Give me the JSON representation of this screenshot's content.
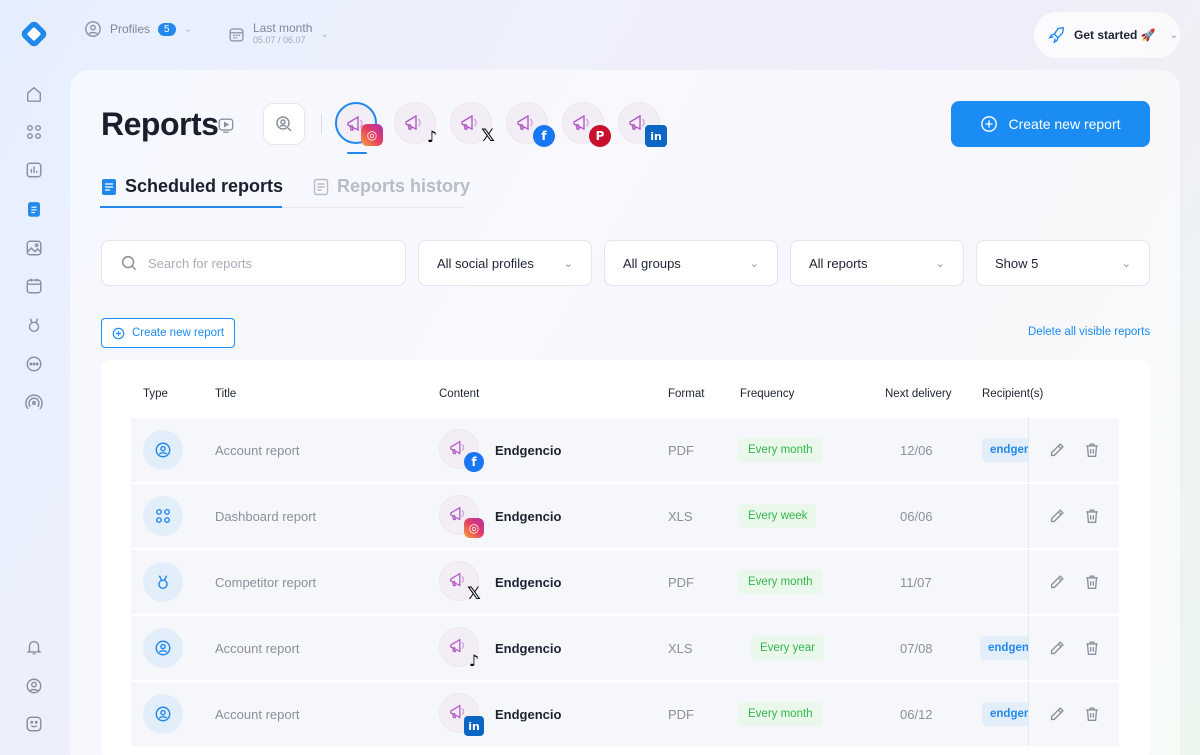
{
  "topbar": {
    "profiles_label": "Profiles",
    "profiles_count": "5",
    "period_label": "Last month",
    "period_range": "05.07 / 06.07",
    "get_started": "Get started 🚀"
  },
  "sidebar": {
    "items": [
      "home-icon",
      "grid-icon",
      "chart-icon",
      "report-icon",
      "media-icon",
      "calendar-icon",
      "trophy-icon",
      "chat-icon",
      "broadcast-icon"
    ],
    "bottom": [
      "bell-icon",
      "user-icon",
      "smile-icon"
    ],
    "active": "report-icon"
  },
  "page": {
    "title": "Reports",
    "create_button": "Create new report"
  },
  "profiles": [
    {
      "network": "instagram",
      "selected": true
    },
    {
      "network": "tiktok"
    },
    {
      "network": "x"
    },
    {
      "network": "facebook"
    },
    {
      "network": "pinterest"
    },
    {
      "network": "linkedin"
    }
  ],
  "tabs": {
    "scheduled": "Scheduled reports",
    "history": "Reports history"
  },
  "filters": {
    "search_placeholder": "Search for reports",
    "profiles": "All social profiles",
    "groups": "All groups",
    "reports": "All reports",
    "show": "Show 5"
  },
  "actions": {
    "create_small": "Create new report",
    "delete_all": "Delete all visible reports"
  },
  "table": {
    "headers": {
      "type": "Type",
      "title": "Title",
      "content": "Content",
      "format": "Format",
      "frequency": "Frequency",
      "next": "Next delivery",
      "recipients": "Recipient(s)"
    },
    "rows": [
      {
        "type_icon": "account-icon",
        "title": "Account report",
        "content": "Endgencio",
        "network": "facebook",
        "format": "PDF",
        "frequency": "Every month",
        "next": "12/06",
        "recipient": "endgen"
      },
      {
        "type_icon": "dashboard-icon",
        "title": "Dashboard report",
        "content": "Endgencio",
        "network": "instagram",
        "format": "XLS",
        "frequency": "Every week",
        "next": "06/06",
        "recipient": ""
      },
      {
        "type_icon": "competitor-icon",
        "title": "Competitor report",
        "content": "Endgencio",
        "network": "x",
        "format": "PDF",
        "frequency": "Every month",
        "next": "11/07",
        "recipient": ""
      },
      {
        "type_icon": "account-icon",
        "title": "Account report",
        "content": "Endgencio",
        "network": "tiktok",
        "format": "XLS",
        "frequency": "Every year",
        "next": "07/08",
        "recipient": "endgen"
      },
      {
        "type_icon": "account-icon",
        "title": "Account report",
        "content": "Endgencio",
        "network": "linkedin",
        "format": "PDF",
        "frequency": "Every month",
        "next": "06/12",
        "recipient": "endgen"
      }
    ]
  },
  "colors": {
    "accent": "#1b8cf3",
    "frequency_bg": "#eaf8ec",
    "frequency_text": "#33b54a"
  }
}
